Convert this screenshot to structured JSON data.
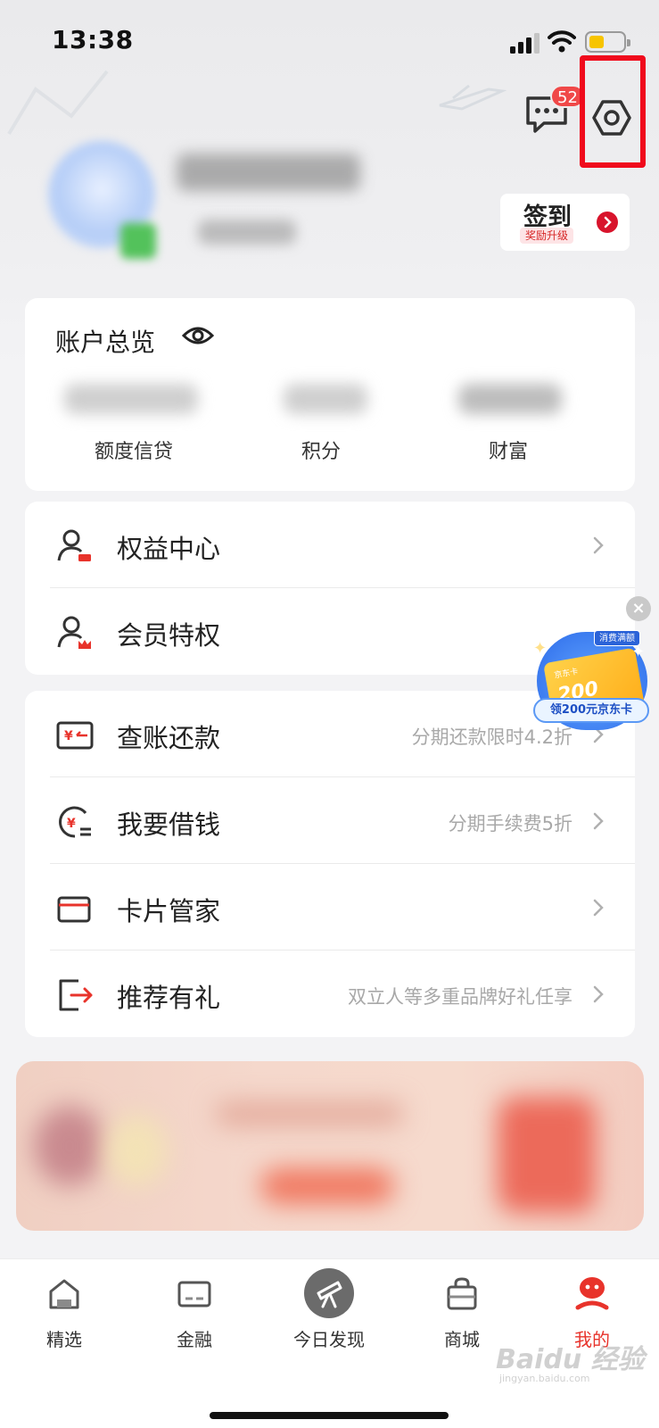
{
  "status_bar": {
    "time": "13:38"
  },
  "header": {
    "message_badge": "52",
    "sign_in": {
      "title": "签到",
      "subtitle": "奖励升级"
    }
  },
  "overview": {
    "title": "账户总览",
    "items": [
      {
        "label": "额度信贷"
      },
      {
        "label": "积分"
      },
      {
        "label": "财富"
      }
    ]
  },
  "list1": [
    {
      "label": "权益中心",
      "icon": "rights-center-icon"
    },
    {
      "label": "会员特权",
      "icon": "member-privilege-icon"
    }
  ],
  "list2": [
    {
      "label": "查账还款",
      "desc": "分期还款限时4.2折",
      "icon": "bill-repay-icon"
    },
    {
      "label": "我要借钱",
      "desc": "分期手续费5折",
      "icon": "borrow-money-icon"
    },
    {
      "label": "卡片管家",
      "desc": "",
      "icon": "card-manager-icon"
    },
    {
      "label": "推荐有礼",
      "desc": "双立人等多重品牌好礼任享",
      "icon": "referral-gift-icon"
    }
  ],
  "promo": {
    "tag": "消费满额",
    "card_small": "京东卡",
    "amount": "200",
    "banner": "领200元京东卡"
  },
  "tabbar": [
    {
      "label": "精选",
      "icon": "home-icon"
    },
    {
      "label": "金融",
      "icon": "finance-card-icon"
    },
    {
      "label": "今日发现",
      "icon": "telescope-icon"
    },
    {
      "label": "商城",
      "icon": "shopping-bag-icon"
    },
    {
      "label": "我的",
      "icon": "profile-icon",
      "active": true
    }
  ],
  "colors": {
    "accent": "#e8332b",
    "highlight": "#f00a1c",
    "badge": "#f04848"
  },
  "watermark": {
    "main": "Baidu 经验",
    "sub": "jingyan.baidu.com"
  }
}
